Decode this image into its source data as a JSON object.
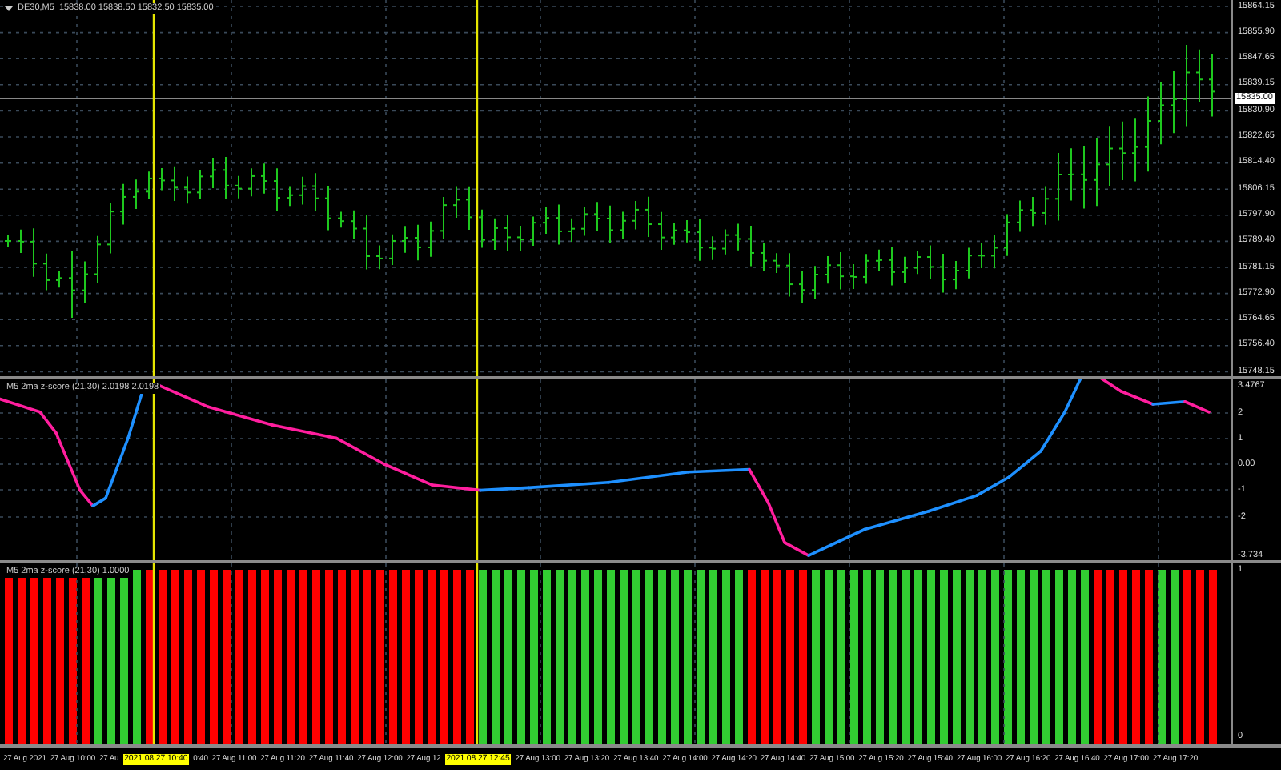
{
  "main_panel": {
    "symbol": "DE30,M5",
    "quotes": [
      "15838.00",
      "15838.50",
      "15832.50",
      "15835.00"
    ],
    "price_ticks": [
      "15864.15",
      "15855.90",
      "15847.65",
      "15839.15",
      "15830.90",
      "15822.65",
      "15814.40",
      "15806.15",
      "15797.90",
      "15789.40",
      "15781.15",
      "15772.90",
      "15764.65",
      "15756.40",
      "15748.15"
    ],
    "current_price": "15835.00"
  },
  "zscore_panel": {
    "title": "M5 2ma z-score (21,30) 2.0198 2.0198",
    "ticks": [
      "3.4767",
      "2",
      "1",
      "0.00",
      "-1",
      "-2",
      "-3.734"
    ]
  },
  "histogram_panel": {
    "title": "M5 2ma z-score (21,30) 1.0000",
    "ticks": [
      "1",
      "0"
    ]
  },
  "time_axis": [
    {
      "kind": "tick",
      "text": "27 Aug 2021"
    },
    {
      "kind": "tick",
      "text": "27 Aug 10:00"
    },
    {
      "kind": "cut",
      "text": "27 Au"
    },
    {
      "kind": "marker",
      "text": "2021.08.27 10:40"
    },
    {
      "kind": "cut",
      "text": "0:40"
    },
    {
      "kind": "tick",
      "text": "27 Aug 11:00"
    },
    {
      "kind": "tick",
      "text": "27 Aug 11:20"
    },
    {
      "kind": "tick",
      "text": "27 Aug 11:40"
    },
    {
      "kind": "tick",
      "text": "27 Aug 12:00"
    },
    {
      "kind": "cut",
      "text": "27 Aug 12"
    },
    {
      "kind": "marker",
      "text": "2021.08.27 12:45"
    },
    {
      "kind": "tick",
      "text": "27 Aug 13:00"
    },
    {
      "kind": "tick",
      "text": "27 Aug 13:20"
    },
    {
      "kind": "tick",
      "text": "27 Aug 13:40"
    },
    {
      "kind": "tick",
      "text": "27 Aug 14:00"
    },
    {
      "kind": "tick",
      "text": "27 Aug 14:20"
    },
    {
      "kind": "tick",
      "text": "27 Aug 14:40"
    },
    {
      "kind": "tick",
      "text": "27 Aug 15:00"
    },
    {
      "kind": "tick",
      "text": "27 Aug 15:20"
    },
    {
      "kind": "tick",
      "text": "27 Aug 15:40"
    },
    {
      "kind": "tick",
      "text": "27 Aug 16:00"
    },
    {
      "kind": "tick",
      "text": "27 Aug 16:20"
    },
    {
      "kind": "tick",
      "text": "27 Aug 16:40"
    },
    {
      "kind": "tick",
      "text": "27 Aug 17:00"
    },
    {
      "kind": "tick",
      "text": "27 Aug 17:20"
    }
  ]
}
